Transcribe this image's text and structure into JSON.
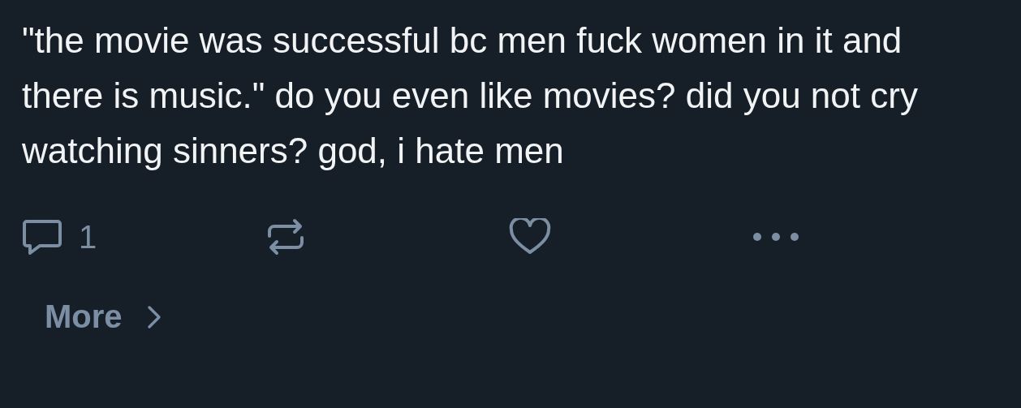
{
  "post": {
    "text": "\"the movie was successful bc men fuck women in it and there is music.\" do you even like movies? did you not cry watching sinners? god, i hate men",
    "reply_count": "1"
  },
  "more": {
    "label": "More"
  }
}
